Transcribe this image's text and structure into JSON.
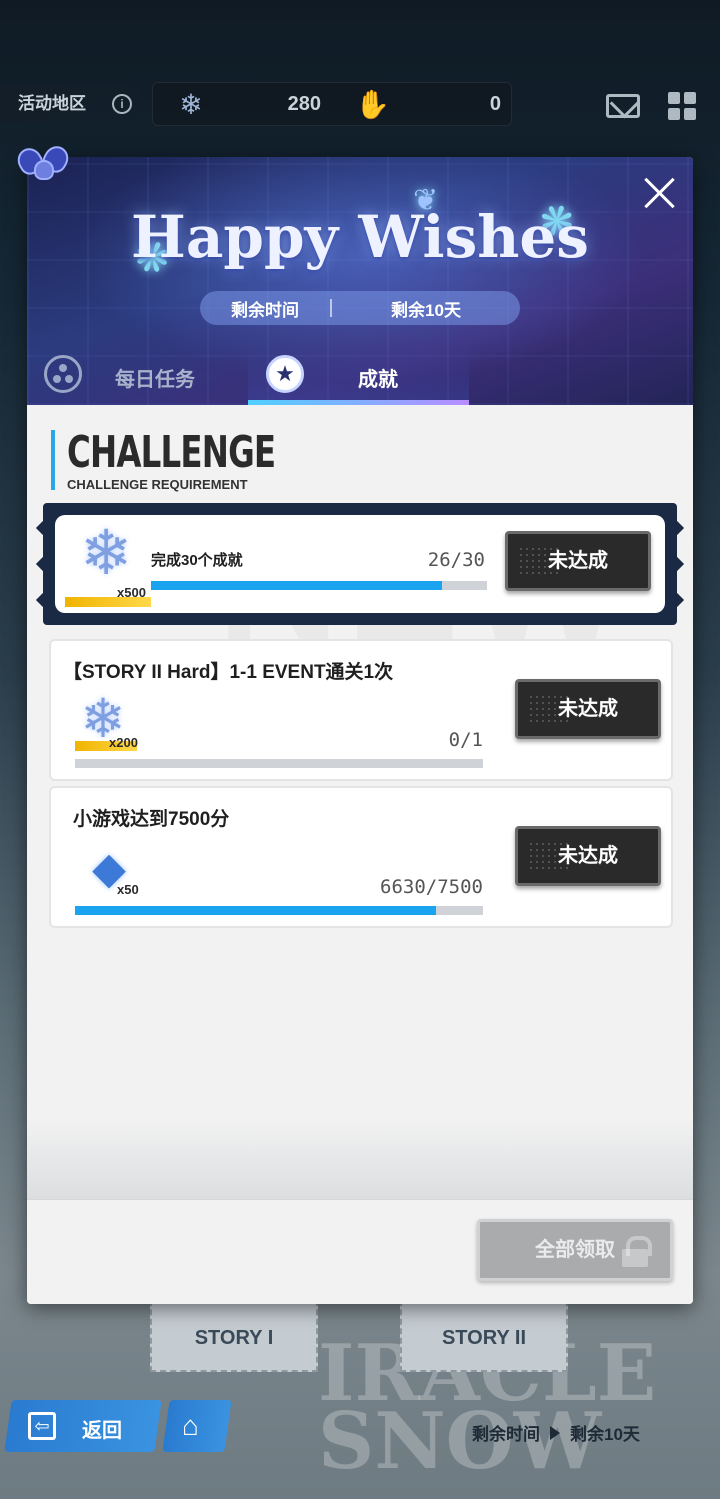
{
  "topbar": {
    "area_label": "活动地区",
    "info_icon": "ⓘ",
    "currency_1_icon": "snowflake-icon",
    "currency_1_value": "280",
    "currency_2_icon": "glove-icon",
    "currency_2_value": "0"
  },
  "banner": {
    "title": "Happy Wishes",
    "timer_label": "剩余时间",
    "timer_value": "剩余10天"
  },
  "tabs": [
    {
      "label": "每日任务",
      "active": false
    },
    {
      "label": "成就",
      "active": true
    }
  ],
  "section": {
    "heading": "CHALLENGE",
    "subheading": "CHALLENGE REQUIREMENT"
  },
  "watermark_text": "NEW",
  "tasks": [
    {
      "title": "完成30个成就",
      "reward_icon": "snowflake-icon",
      "reward_qty": "x500",
      "progress_text": "26/30",
      "progress_fraction": 0.867,
      "status": "未达成",
      "featured": true
    },
    {
      "title": "【STORY II Hard】1-1 EVENT通关1次",
      "reward_icon": "snowflake-icon",
      "reward_qty": "x200",
      "progress_text": "0/1",
      "progress_fraction": 0,
      "status": "未达成",
      "featured": false
    },
    {
      "title": "小游戏达到7500分",
      "reward_icon": "crystal-icon",
      "reward_qty": "x50",
      "progress_text": "6630/7500",
      "progress_fraction": 0.884,
      "status": "未达成",
      "featured": false
    }
  ],
  "footer": {
    "claim_all_label": "全部领取",
    "claim_all_enabled": false
  },
  "background": {
    "story_1": "STORY I",
    "story_2": "STORY II",
    "back_label": "返回",
    "timer_label": "剩余时间",
    "timer_value": "剩余10天",
    "logo_text": "IRACLE SNOW"
  },
  "colors": {
    "accent_blue": "#1aa3ef",
    "button_dark": "#2a2a2a",
    "reward_gold": "#f0b400"
  }
}
